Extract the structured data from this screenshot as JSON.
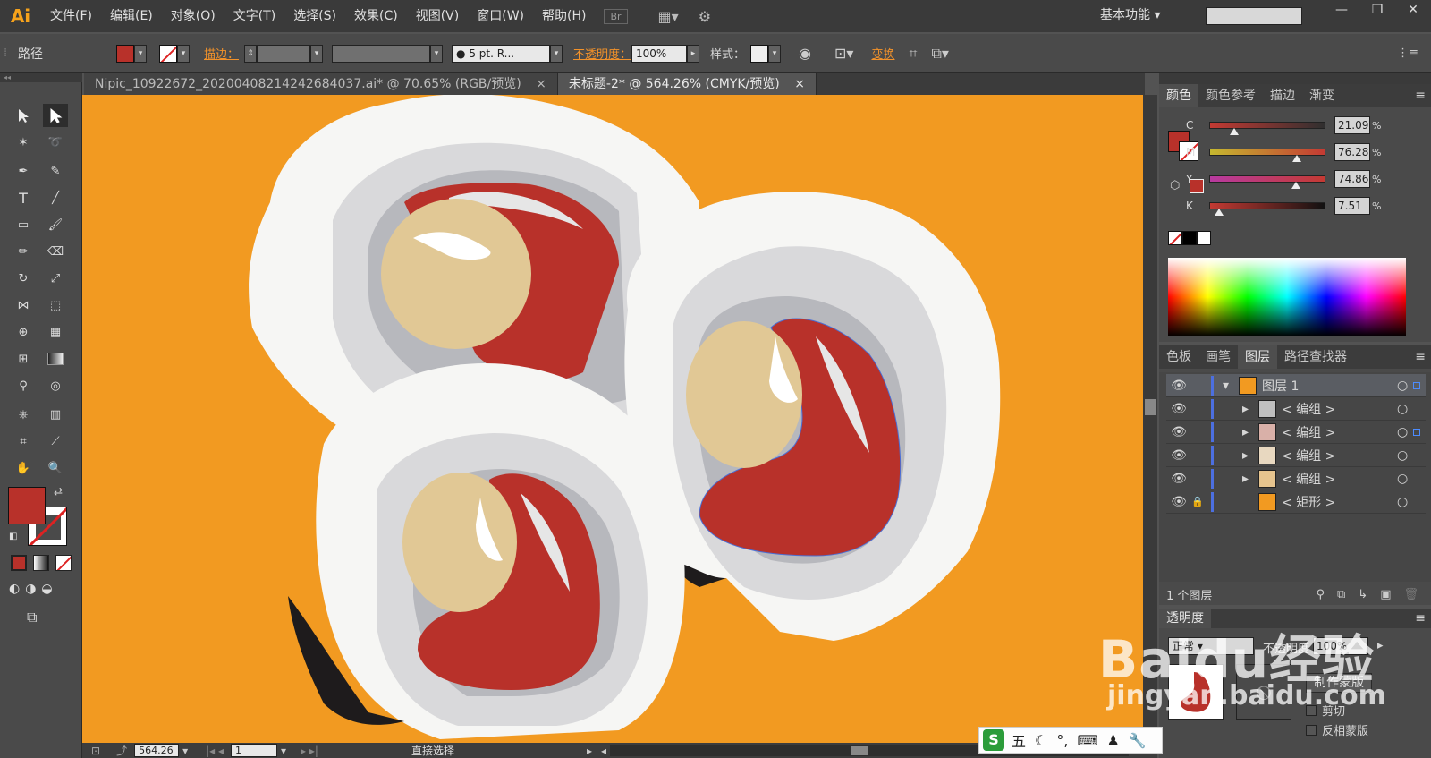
{
  "app": {
    "logo": "Ai",
    "workspace": "基本功能"
  },
  "menu": [
    "文件(F)",
    "编辑(E)",
    "对象(O)",
    "文字(T)",
    "选择(S)",
    "效果(C)",
    "视图(V)",
    "窗口(W)",
    "帮助(H)"
  ],
  "menu_box": "Br",
  "control": {
    "object_type": "路径",
    "stroke_label": "描边：",
    "brush_label": "5 pt. R...",
    "opacity_label": "不透明度：",
    "opacity_value": "100%",
    "style_label": "样式：",
    "transform_label": "变换"
  },
  "tabs": [
    {
      "label": "Nipic_10922672_20200408214242684037.ai* @ 70.65% (RGB/预览)"
    },
    {
      "label": "未标题-2* @ 564.26% (CMYK/预览)"
    }
  ],
  "tab_close": "×",
  "color_panel": {
    "tabs": [
      "颜色",
      "颜色参考",
      "描边",
      "渐变"
    ],
    "channels": [
      {
        "label": "C",
        "value": "21.09",
        "level": 0.21
      },
      {
        "label": "M",
        "value": "76.28",
        "level": 0.76
      },
      {
        "label": "Y",
        "value": "74.86",
        "level": 0.75
      },
      {
        "label": "K",
        "value": "7.51",
        "level": 0.08
      }
    ],
    "pct_sign": "%"
  },
  "layers_panel": {
    "tabs": [
      "色板",
      "画笔",
      "图层",
      "路径查找器"
    ],
    "layers": [
      {
        "name": "图层 1",
        "level": 0
      },
      {
        "name": "< 编组 >",
        "level": 1
      },
      {
        "name": "< 编组 >",
        "level": 1
      },
      {
        "name": "< 编组 >",
        "level": 1
      },
      {
        "name": "< 编组 >",
        "level": 1
      },
      {
        "name": "< 矩形 >",
        "level": 1
      }
    ],
    "count": "1 个图层"
  },
  "transparency_panel": {
    "title": "透明度",
    "mode": "正常",
    "opacity_label": "不透明度",
    "opacity_value": "100%",
    "make_mask": "制作蒙版",
    "clip": "剪切",
    "invert_mask": "反相蒙版"
  },
  "status": {
    "zoom": "564.26",
    "artboard": "1",
    "tool": "直接选择"
  },
  "watermark": {
    "brand": "Baidu经验",
    "url": "jingyan.baidu.com"
  },
  "ime": {
    "text": "五"
  },
  "colors": {
    "fill": "#b8312a",
    "accent": "#f3922a",
    "canvas": "#f29a21"
  }
}
